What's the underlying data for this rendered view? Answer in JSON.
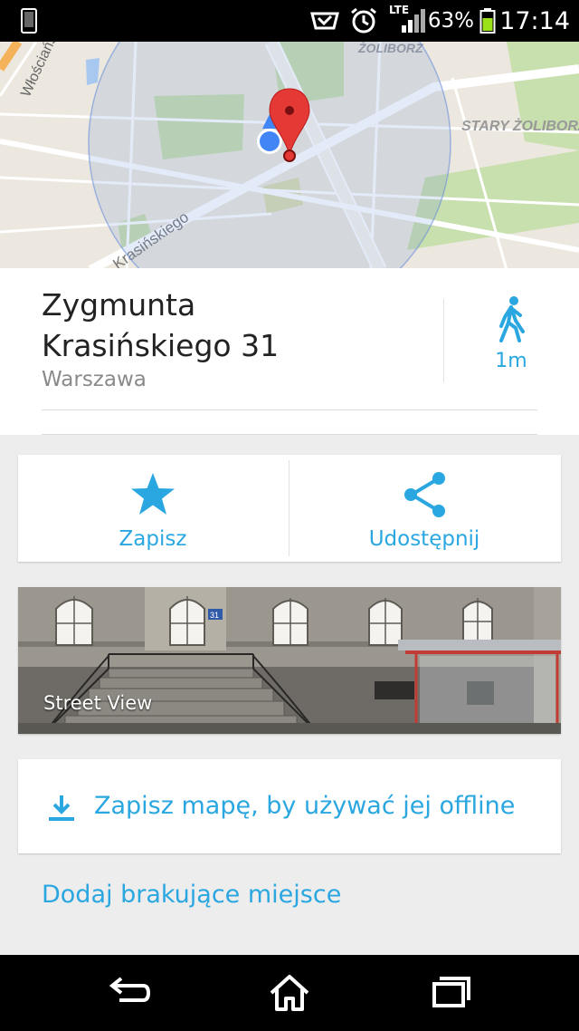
{
  "status_bar": {
    "network": "LTE",
    "battery_percent": "63%",
    "time": "17:14"
  },
  "map": {
    "labels": {
      "street_top_left": "Włościańska",
      "district_top": "ŻOLIBORZ",
      "district_right": "STARY ŻOLIBORZ",
      "street_diagonal": "Krasińskiego"
    },
    "colors": {
      "accuracy_circle": "#4285f4",
      "pin": "#e53935"
    }
  },
  "place": {
    "title_line1": "Zygmunta",
    "title_line2": "Krasińskiego 31",
    "subtitle": "Warszawa",
    "walk_distance": "1m"
  },
  "actions": {
    "save_label": "Zapisz",
    "share_label": "Udostępnij"
  },
  "street_view": {
    "label": "Street View",
    "house_number": "31"
  },
  "offline": {
    "label": "Zapisz mapę, by używać jej offline"
  },
  "add_place": {
    "label": "Dodaj brakujące miejsce"
  },
  "theme": {
    "accent": "#2aa7e0"
  }
}
